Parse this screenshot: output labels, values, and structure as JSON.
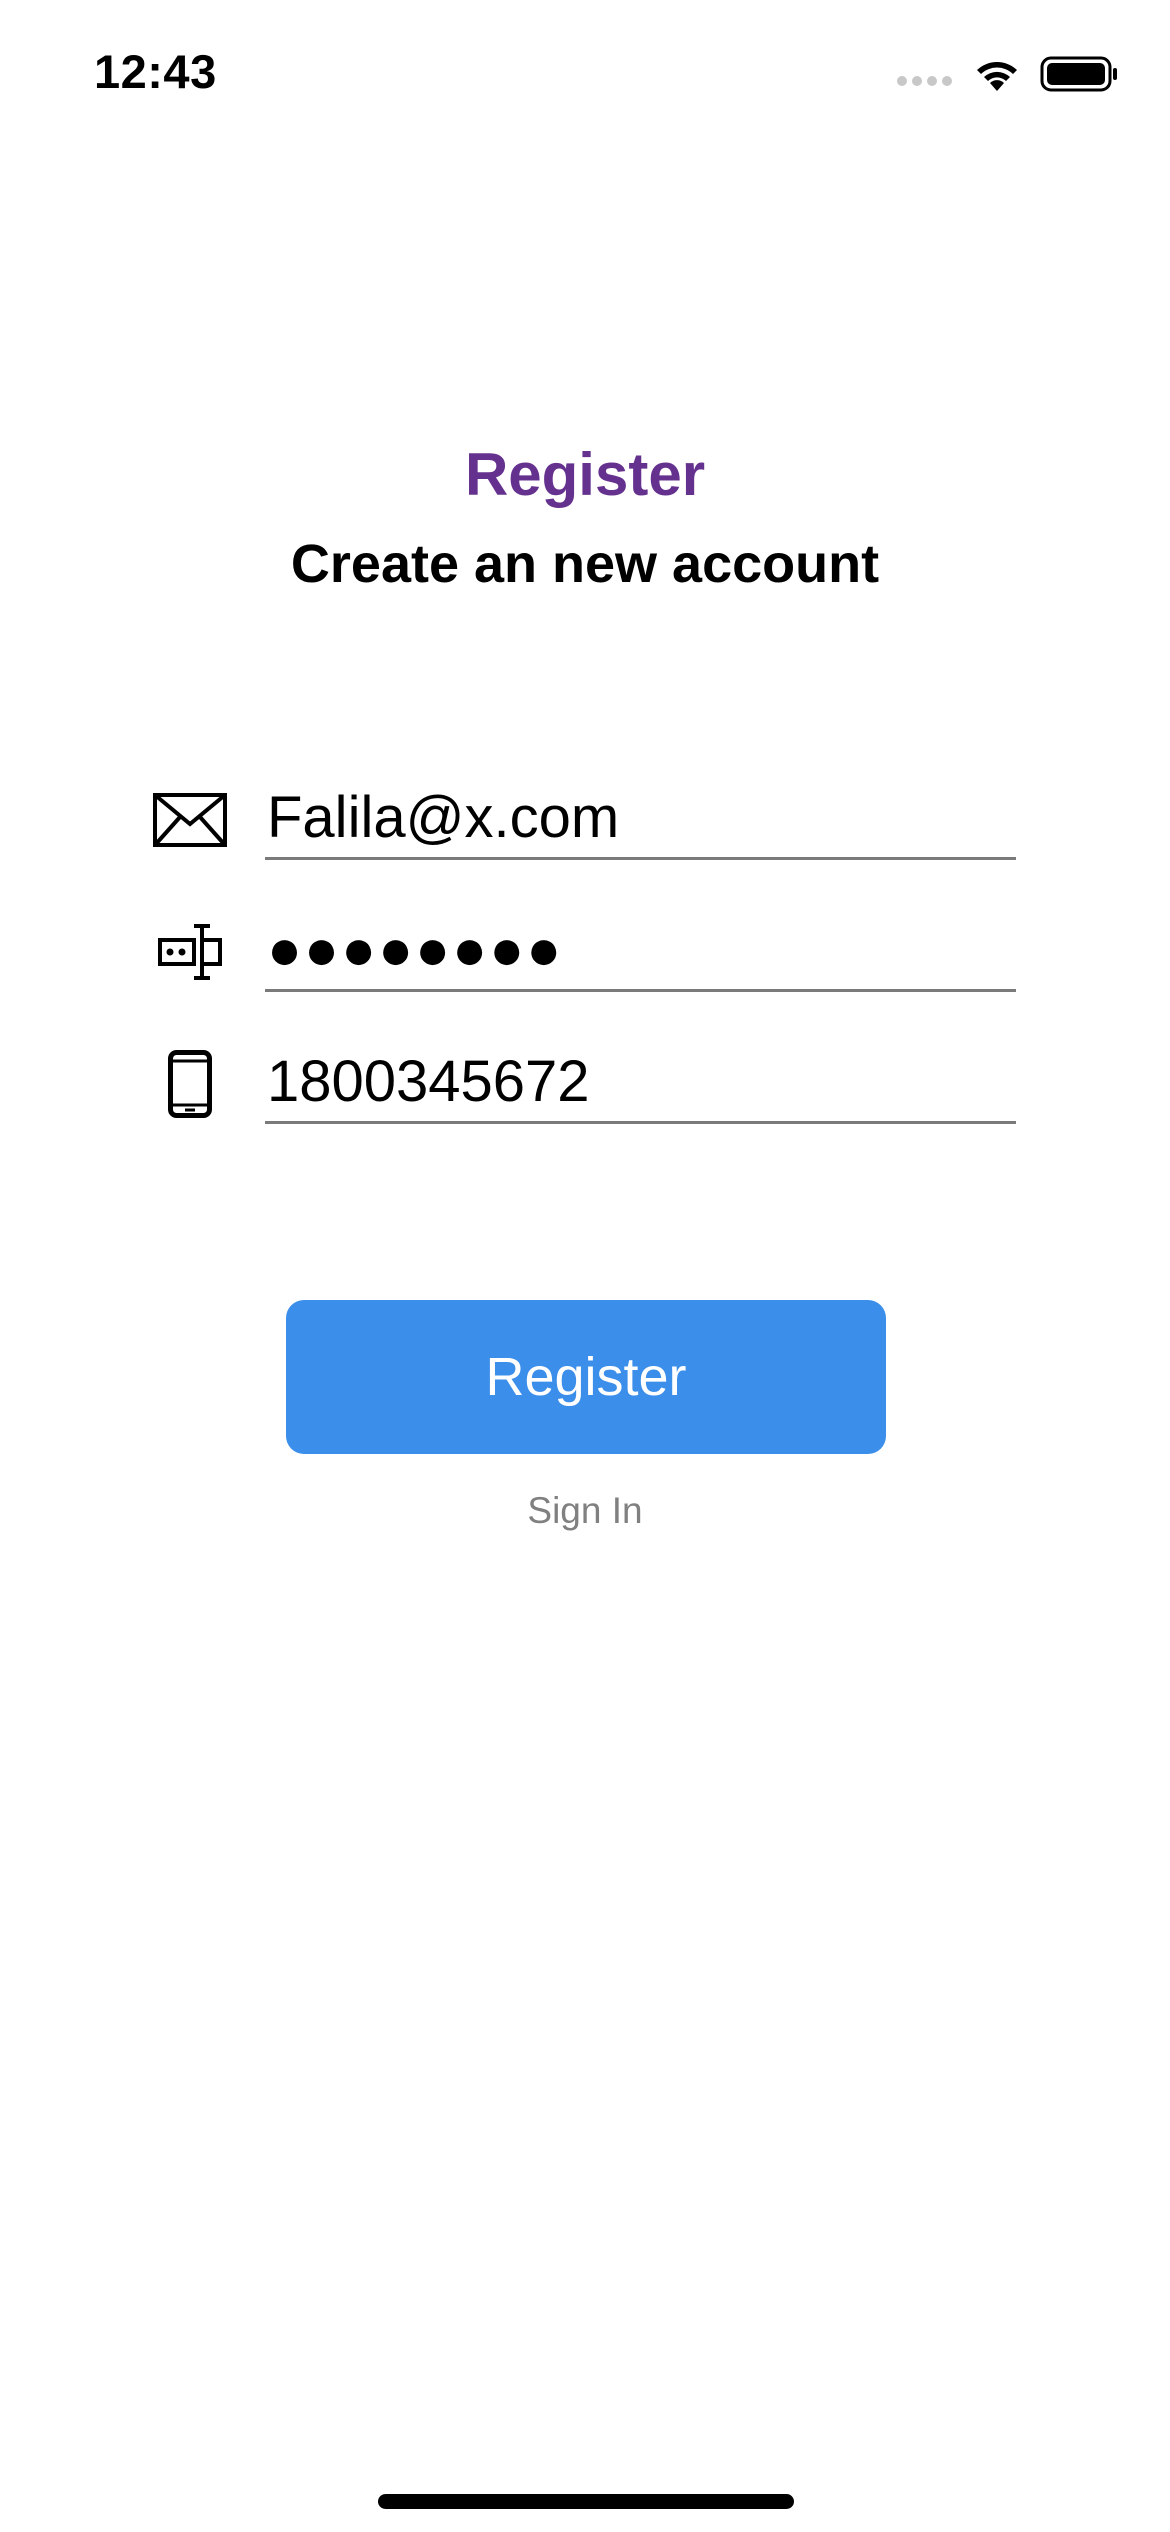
{
  "status_bar": {
    "time": "12:43",
    "icons": [
      "signal-icon",
      "wifi-icon",
      "battery-icon"
    ]
  },
  "header": {
    "title": "Register",
    "subtitle": "Create an new account"
  },
  "form": {
    "email": {
      "value": "Falila@x.com",
      "icon": "envelope-icon"
    },
    "password": {
      "value": "●●●●●●●●",
      "icon": "password-icon"
    },
    "phone": {
      "value": "1800345672",
      "icon": "phone-icon"
    }
  },
  "actions": {
    "register_label": "Register",
    "sign_in_label": "Sign In"
  },
  "colors": {
    "title": "#65318f",
    "button": "#3b8eea",
    "link": "#808080",
    "underline": "#7a7a7a"
  }
}
